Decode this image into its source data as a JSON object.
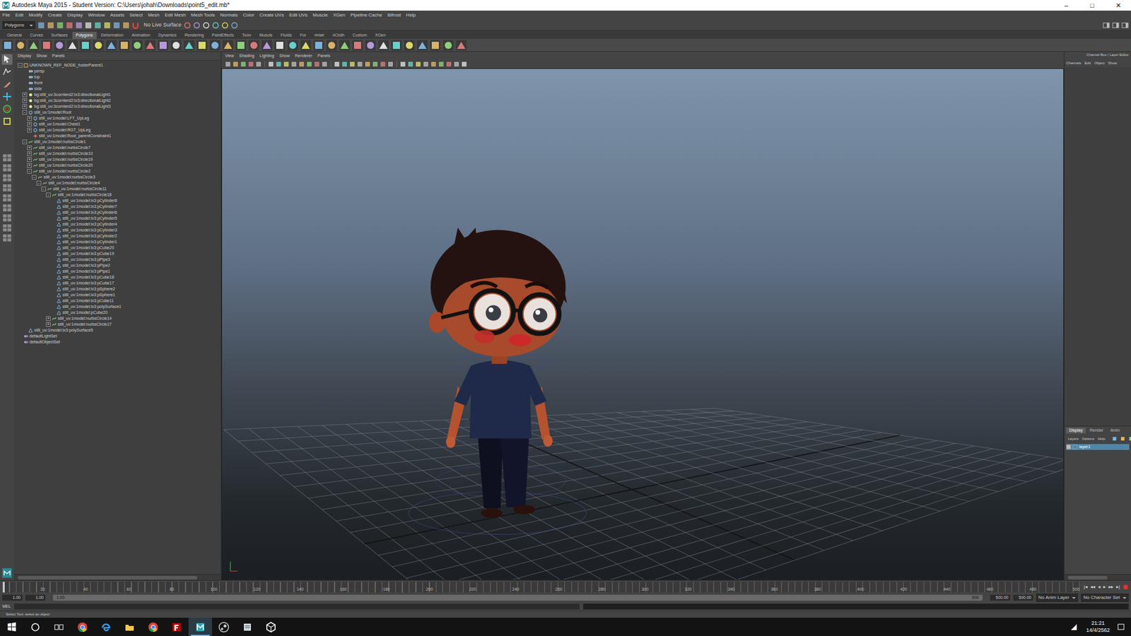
{
  "window": {
    "title": "Autodesk Maya 2015 - Student Version: C:\\Users\\johah\\Downloads\\point5_edit.mb*",
    "controls": [
      "–",
      "□",
      "✕"
    ]
  },
  "menu": [
    "File",
    "Edit",
    "Modify",
    "Create",
    "Display",
    "Window",
    "Assets",
    "Select",
    "Mesh",
    "Edit Mesh",
    "Mesh Tools",
    "Normals",
    "Color",
    "Create UVs",
    "Edit UVs",
    "Muscle",
    "XGen",
    "Pipeline Cache",
    "Bifrost",
    "Help"
  ],
  "status_line": {
    "mode": "Polygons",
    "live_surface": "No Live Surface"
  },
  "shelf": {
    "tabs": [
      {
        "label": "General",
        "selected": false
      },
      {
        "label": "Curves",
        "selected": false
      },
      {
        "label": "Surfaces",
        "selected": false
      },
      {
        "label": "Polygons",
        "selected": true
      },
      {
        "label": "Deformation",
        "selected": false
      },
      {
        "label": "Animation",
        "selected": false
      },
      {
        "label": "Dynamics",
        "selected": false
      },
      {
        "label": "Rendering",
        "selected": false
      },
      {
        "label": "PaintEffects",
        "selected": false
      },
      {
        "label": "Toon",
        "selected": false
      },
      {
        "label": "Muscle",
        "selected": false
      },
      {
        "label": "Fluids",
        "selected": false
      },
      {
        "label": "Fur",
        "selected": false
      },
      {
        "label": "nHair",
        "selected": false
      },
      {
        "label": "nCloth",
        "selected": false
      },
      {
        "label": "Custom",
        "selected": false
      },
      {
        "label": "XGen",
        "selected": false
      }
    ]
  },
  "toolbox": {
    "tools": [
      {
        "selected": true
      },
      {
        "selected": false
      },
      {
        "selected": false
      },
      {
        "selected": false
      },
      {
        "selected": false
      },
      {
        "selected": false
      }
    ]
  },
  "outliner": {
    "menu": [
      "Display",
      "Show",
      "Panels"
    ],
    "items": [
      {
        "label": "UNKNOWN_REF_NODE_fosterParent1",
        "depth": 0,
        "toggle": "-",
        "kind": "ref",
        "selected": false
      },
      {
        "label": "persp",
        "depth": 1,
        "toggle": "",
        "kind": "camera",
        "selected": false
      },
      {
        "label": "top",
        "depth": 1,
        "toggle": "",
        "kind": "camera",
        "selected": false
      },
      {
        "label": "front",
        "depth": 1,
        "toggle": "",
        "kind": "camera",
        "selected": false
      },
      {
        "label": "side",
        "depth": 1,
        "toggle": "",
        "kind": "camera",
        "selected": false
      },
      {
        "label": "bg:still_uv:3cornlerd2:lx3:directionalLight1",
        "depth": 1,
        "toggle": "+",
        "kind": "light",
        "selected": false
      },
      {
        "label": "bg:still_uv:3cornlerd2:lx3:directionalLight2",
        "depth": 1,
        "toggle": "+",
        "kind": "light",
        "selected": false
      },
      {
        "label": "bg:still_uv:3cornlerd2:lx3:directionalLight3",
        "depth": 1,
        "toggle": "+",
        "kind": "light",
        "selected": false
      },
      {
        "label": "still_uv:1model:Root",
        "depth": 1,
        "toggle": "-",
        "kind": "joint",
        "selected": false
      },
      {
        "label": "still_uv:1model:LFT_UpLeg",
        "depth": 2,
        "toggle": "+",
        "kind": "joint",
        "selected": false
      },
      {
        "label": "still_uv:1model:Chest1",
        "depth": 2,
        "toggle": "+",
        "kind": "joint",
        "selected": false
      },
      {
        "label": "still_uv:1model:RGT_UpLeg",
        "depth": 2,
        "toggle": "+",
        "kind": "joint",
        "selected": false
      },
      {
        "label": "still_uv:1model:Root_parentConstraint1",
        "depth": 2,
        "toggle": "",
        "kind": "constraint",
        "selected": false
      },
      {
        "label": "still_uv:1model:nurbsCircle1",
        "depth": 1,
        "toggle": "-",
        "kind": "curve",
        "selected": false
      },
      {
        "label": "still_uv:1model:nurbsCircle7",
        "depth": 2,
        "toggle": "+",
        "kind": "curve",
        "selected": false
      },
      {
        "label": "still_uv:1model:nurbsCircle10",
        "depth": 2,
        "toggle": "+",
        "kind": "curve",
        "selected": false
      },
      {
        "label": "still_uv:1model:nurbsCircle19",
        "depth": 2,
        "toggle": "+",
        "kind": "curve",
        "selected": false
      },
      {
        "label": "still_uv:1model:nurbsCircle20",
        "depth": 2,
        "toggle": "+",
        "kind": "curve",
        "selected": false
      },
      {
        "label": "still_uv:1model:nurbsCircle2",
        "depth": 2,
        "toggle": "-",
        "kind": "curve",
        "selected": false
      },
      {
        "label": "still_uv:1model:nurbsCircle3",
        "depth": 3,
        "toggle": "-",
        "kind": "curve",
        "selected": false
      },
      {
        "label": "still_uv:1model:nurbsCircle4",
        "depth": 4,
        "toggle": "-",
        "kind": "curve",
        "selected": false
      },
      {
        "label": "still_uv:1model:nurbsCircle11",
        "depth": 5,
        "toggle": "-",
        "kind": "curve",
        "selected": false
      },
      {
        "label": "still_uv:1model:nurbsCircle18",
        "depth": 6,
        "toggle": "-",
        "kind": "curve",
        "selected": false
      },
      {
        "label": "still_uv:1model:lx3:pCylinder8",
        "depth": 7,
        "toggle": "",
        "kind": "mesh",
        "selected": false
      },
      {
        "label": "still_uv:1model:lx3:pCylinder7",
        "depth": 7,
        "toggle": "",
        "kind": "mesh",
        "selected": false
      },
      {
        "label": "still_uv:1model:lx3:pCylinder6",
        "depth": 7,
        "toggle": "",
        "kind": "mesh",
        "selected": false
      },
      {
        "label": "still_uv:1model:lx3:pCylinder5",
        "depth": 7,
        "toggle": "",
        "kind": "mesh",
        "selected": false
      },
      {
        "label": "still_uv:1model:lx3:pCylinder4",
        "depth": 7,
        "toggle": "",
        "kind": "mesh",
        "selected": false
      },
      {
        "label": "still_uv:1model:lx3:pCylinder3",
        "depth": 7,
        "toggle": "",
        "kind": "mesh",
        "selected": false
      },
      {
        "label": "still_uv:1model:lx3:pCylinder2",
        "depth": 7,
        "toggle": "",
        "kind": "mesh",
        "selected": false
      },
      {
        "label": "still_uv:1model:lx3:pCylinder1",
        "depth": 7,
        "toggle": "",
        "kind": "mesh",
        "selected": false
      },
      {
        "label": "still_uv:1model:lx3:pCube20",
        "depth": 7,
        "toggle": "",
        "kind": "mesh",
        "selected": false
      },
      {
        "label": "still_uv:1model:lx3:pCube19",
        "depth": 7,
        "toggle": "",
        "kind": "mesh",
        "selected": false
      },
      {
        "label": "still_uv:1model:lx3:pPipe3",
        "depth": 7,
        "toggle": "",
        "kind": "mesh",
        "selected": false
      },
      {
        "label": "still_uv:1model:lx3:pPipe2",
        "depth": 7,
        "toggle": "",
        "kind": "mesh",
        "selected": false
      },
      {
        "label": "still_uv:1model:lx3:pPipe1",
        "depth": 7,
        "toggle": "",
        "kind": "mesh",
        "selected": false
      },
      {
        "label": "still_uv:1model:lx3:pCube18",
        "depth": 7,
        "toggle": "",
        "kind": "mesh",
        "selected": false
      },
      {
        "label": "still_uv:1model:lx3:pCube17",
        "depth": 7,
        "toggle": "",
        "kind": "mesh",
        "selected": false
      },
      {
        "label": "still_uv:1model:lx3:pSphere2",
        "depth": 7,
        "toggle": "",
        "kind": "mesh",
        "selected": false
      },
      {
        "label": "still_uv:1model:lx3:pSphere1",
        "depth": 7,
        "toggle": "",
        "kind": "mesh",
        "selected": false
      },
      {
        "label": "still_uv:1model:lx3:pCube11",
        "depth": 7,
        "toggle": "",
        "kind": "mesh",
        "selected": false
      },
      {
        "label": "still_uv:1model:lx3:polySurface1",
        "depth": 7,
        "toggle": "",
        "kind": "mesh",
        "selected": false
      },
      {
        "label": "still_uv:1model:pCube20",
        "depth": 7,
        "toggle": "",
        "kind": "mesh",
        "selected": false
      },
      {
        "label": "still_uv:1model:nurbsCircle14",
        "depth": 6,
        "toggle": "+",
        "kind": "curve",
        "selected": false
      },
      {
        "label": "still_uv:1model:nurbsCircle17",
        "depth": 6,
        "toggle": "+",
        "kind": "curve",
        "selected": false
      },
      {
        "label": "still_uv:1model:lx3:polySurface5",
        "depth": 1,
        "toggle": "",
        "kind": "mesh",
        "selected": false
      },
      {
        "label": "defaultLightSet",
        "depth": 0,
        "toggle": "",
        "kind": "set",
        "selected": false
      },
      {
        "label": "defaultObjectSet",
        "depth": 0,
        "toggle": "",
        "kind": "set",
        "selected": false
      }
    ]
  },
  "viewport": {
    "menu": [
      "View",
      "Shading",
      "Lighting",
      "Show",
      "Renderer",
      "Panels"
    ]
  },
  "channel_box": {
    "title": "Channel Box / Layer Editor",
    "menu": [
      "Channels",
      "Edit",
      "Object",
      "Show"
    ]
  },
  "layer_editor": {
    "tabs": [
      {
        "label": "Display",
        "selected": true
      },
      {
        "label": "Render",
        "selected": false
      },
      {
        "label": "Anim",
        "selected": false
      }
    ],
    "menu": [
      "Layers",
      "Options",
      "Help"
    ],
    "layers": [
      {
        "name": "layer1",
        "visible": true,
        "selected": true
      }
    ]
  },
  "time_slider": {
    "ticks": [
      "20",
      "40",
      "60",
      "80",
      "100",
      "120",
      "140",
      "160",
      "180",
      "200",
      "220",
      "240",
      "260",
      "280",
      "300",
      "320",
      "340",
      "360",
      "380",
      "400",
      "420",
      "440",
      "460",
      "480",
      "500"
    ],
    "playback": [
      "|◂",
      "◂◂",
      "◂",
      "▸",
      "▸▸",
      "▸|"
    ]
  },
  "range_slider": {
    "start": "1.00",
    "inner_start": "1.00",
    "bar_start": "1.00",
    "bar_end": "500",
    "inner_end": "500.00",
    "end": "500.00",
    "anim_layer": "No Anim Layer",
    "character_set": "No Character Set"
  },
  "command_line": {
    "label": "MEL"
  },
  "help_line": "Select Tool: select an object",
  "taskbar": {
    "apps": [
      {
        "kind": "chrome",
        "selected": false
      },
      {
        "kind": "edge",
        "selected": false
      },
      {
        "kind": "explorer",
        "selected": false
      },
      {
        "kind": "chrome",
        "selected": false
      },
      {
        "kind": "filezilla",
        "selected": false
      },
      {
        "kind": "maya",
        "selected": true
      },
      {
        "kind": "steam",
        "selected": false
      },
      {
        "kind": "files",
        "selected": false
      },
      {
        "kind": "unity",
        "selected": false
      }
    ],
    "time": "21:21",
    "date": "14/4/2562"
  }
}
